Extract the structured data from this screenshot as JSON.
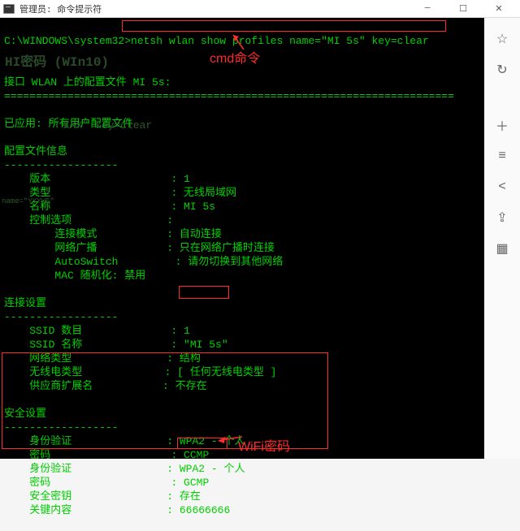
{
  "titlebar": {
    "title": "管理员: 命令提示符"
  },
  "prompt": {
    "path": "C:\\WINDOWS\\system32>",
    "command": "netsh wlan show profiles name=\"MI 5s\" key=clear"
  },
  "lines": {
    "interface_header": "接口 WLAN 上的配置文件 MI 5s:",
    "sep_eq": "=======================================================================",
    "applied": "已应用: 所有用户配置文件",
    "profile_info": "配置文件信息",
    "sep_dash": "------------------",
    "version_k": "    版本",
    "version_v": "1",
    "type_k": "    类型",
    "type_v": "无线局域网",
    "name_k": "    名称",
    "name_v": "MI 5s",
    "control_k": "    控制选项",
    "connmode_k": "        连接模式",
    "connmode_v": "自动连接",
    "broadcast_k": "        网络广播",
    "broadcast_v": "只在网络广播时连接",
    "autosw_k": "        AutoSwitch",
    "autosw_v": "请勿切换到其他网络",
    "macr_k": "        MAC 随机化: 禁用",
    "conn_settings": "连接设置",
    "ssidnum_k": "    SSID 数目",
    "ssidnum_v": "1",
    "ssidname_k": "    SSID 名称",
    "ssidname_v": "\"MI 5s\"",
    "nettype_k": "    网络类型",
    "nettype_v": "结构",
    "radiotype_k": "    无线电类型",
    "radiotype_v": "[ 任何无线电类型 ]",
    "vendor_k": "    供应商扩展名",
    "vendor_v": "不存在",
    "sec_settings": "安全设置",
    "auth_k": "    身份验证",
    "auth_v": "WPA2 - 个人",
    "cipher_k": "    密码",
    "cipher_v": "CCMP",
    "auth2_k": "    身份验证",
    "auth2_v": "WPA2 - 个人",
    "cipher2_k": "    密码",
    "cipher2_v": "GCMP",
    "seckey_k": "    安全密钥",
    "seckey_v": "存在",
    "keycontent_k": "    关键内容",
    "keycontent_v": "66666666"
  },
  "ghost": {
    "line1": "HI密码 (WIn10)",
    "line2": "         XXX\" key=clear",
    "line3": "name=\"YYYWS\""
  },
  "annotations": {
    "cmd_label": "cmd命令",
    "wifi_label": "WiFi密码"
  },
  "sidebar": {
    "icons": [
      "bookmark-icon",
      "history-icon",
      "add-icon",
      "list-icon",
      "share-icon",
      "export-icon",
      "qr-icon"
    ]
  }
}
